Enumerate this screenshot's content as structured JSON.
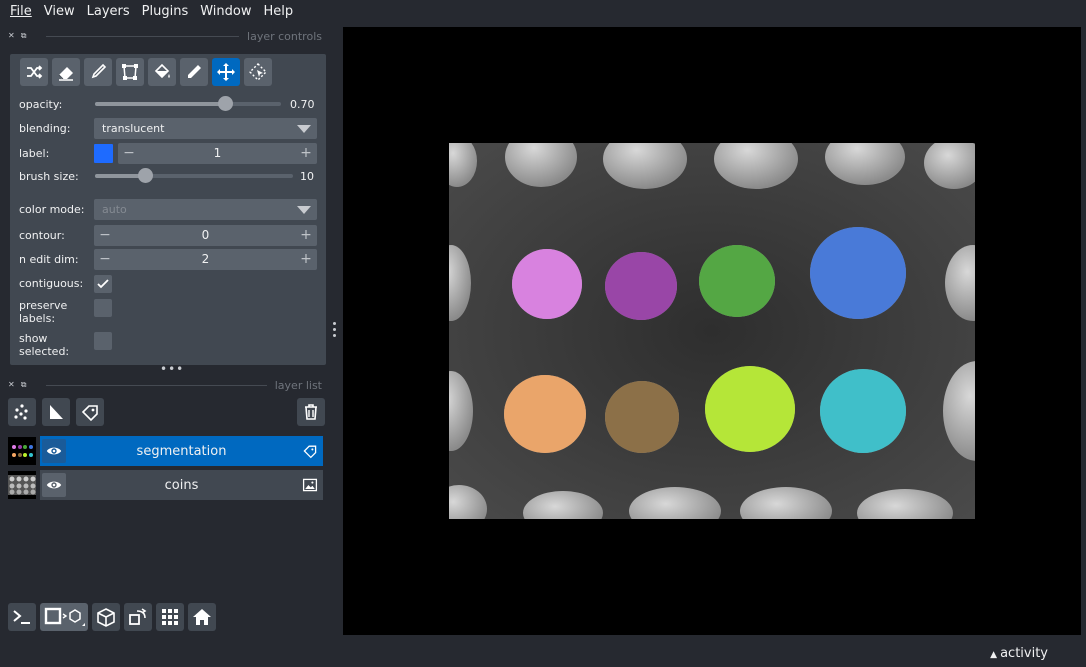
{
  "menu": [
    "File",
    "View",
    "Layers",
    "Plugins",
    "Window",
    "Help"
  ],
  "layer_controls": {
    "title": "layer controls",
    "tools": [
      {
        "name": "shuffle-colors-icon",
        "active": false
      },
      {
        "name": "eraser-icon",
        "active": false
      },
      {
        "name": "paintbrush-icon",
        "active": false
      },
      {
        "name": "polygon-icon",
        "active": false
      },
      {
        "name": "fill-bucket-icon",
        "active": false
      },
      {
        "name": "color-picker-icon",
        "active": false
      },
      {
        "name": "pan-zoom-icon",
        "active": true
      },
      {
        "name": "transform-icon",
        "active": false
      }
    ],
    "opacity_label": "opacity:",
    "opacity_value": "0.70",
    "opacity": 0.7,
    "blending_label": "blending:",
    "blending_value": "translucent",
    "label_label": "label:",
    "label_value": "1",
    "label_color": "#1e6bff",
    "brush_size_label": "brush size:",
    "brush_size_value": "10",
    "brush_size_fraction": 0.25,
    "color_mode_label": "color mode:",
    "color_mode_value": "auto",
    "contour_label": "contour:",
    "contour_value": "0",
    "n_edit_dim_label": "n edit dim:",
    "n_edit_dim_value": "2",
    "contiguous_label": "contiguous:",
    "contiguous_checked": true,
    "preserve_labels_label1": "preserve",
    "preserve_labels_label2": "labels:",
    "preserve_labels_checked": false,
    "show_selected_label1": "show",
    "show_selected_label2": "selected:",
    "show_selected_checked": false
  },
  "layer_list": {
    "title": "layer list",
    "layers": [
      {
        "name": "segmentation",
        "selected": true,
        "type_icon": "labels-tag-icon"
      },
      {
        "name": "coins",
        "selected": false,
        "type_icon": "image-icon"
      }
    ]
  },
  "canvas": {
    "segments": [
      {
        "color": "#e07ee8"
      },
      {
        "color": "#993aa8"
      },
      {
        "color": "#4aa838"
      },
      {
        "color": "#3d75e0"
      },
      {
        "color": "#f5a663"
      },
      {
        "color": "#8a6a3c"
      },
      {
        "color": "#b8f02a"
      },
      {
        "color": "#33c4cf"
      }
    ]
  },
  "status": {
    "activity": "activity"
  }
}
